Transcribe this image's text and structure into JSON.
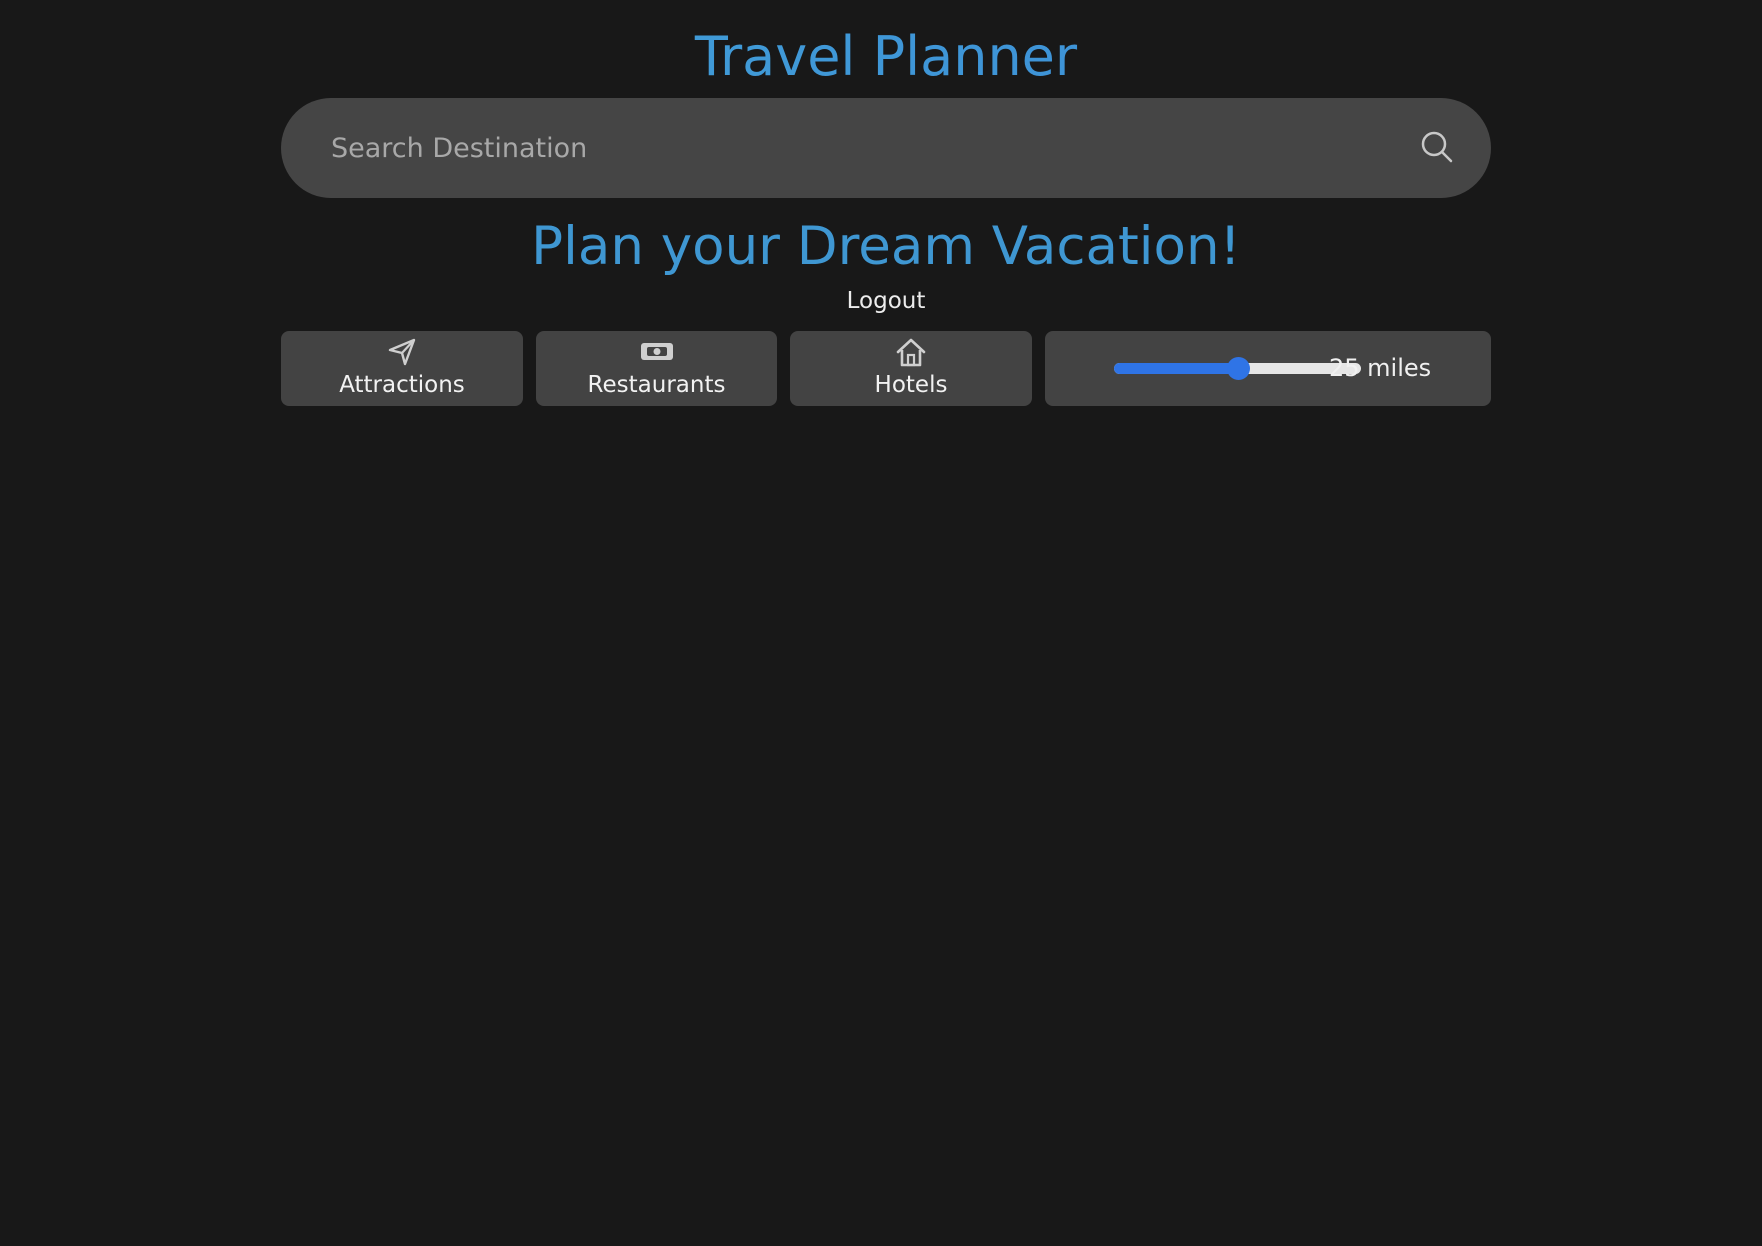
{
  "header": {
    "title": "Travel Planner"
  },
  "search": {
    "placeholder": "Search Destination",
    "value": ""
  },
  "hero": {
    "subtitle": "Plan your Dream Vacation!",
    "logout_label": "Logout"
  },
  "categories": [
    {
      "label": "Attractions",
      "icon": "send-arrow-icon"
    },
    {
      "label": "Restaurants",
      "icon": "cash-icon"
    },
    {
      "label": "Hotels",
      "icon": "home-icon"
    }
  ],
  "radius": {
    "label": "25 miles",
    "fraction": 0.5
  },
  "colors": {
    "background": "#181818",
    "surface": "#434343",
    "accent": "#2f74e6",
    "title": "#3f97d2"
  }
}
